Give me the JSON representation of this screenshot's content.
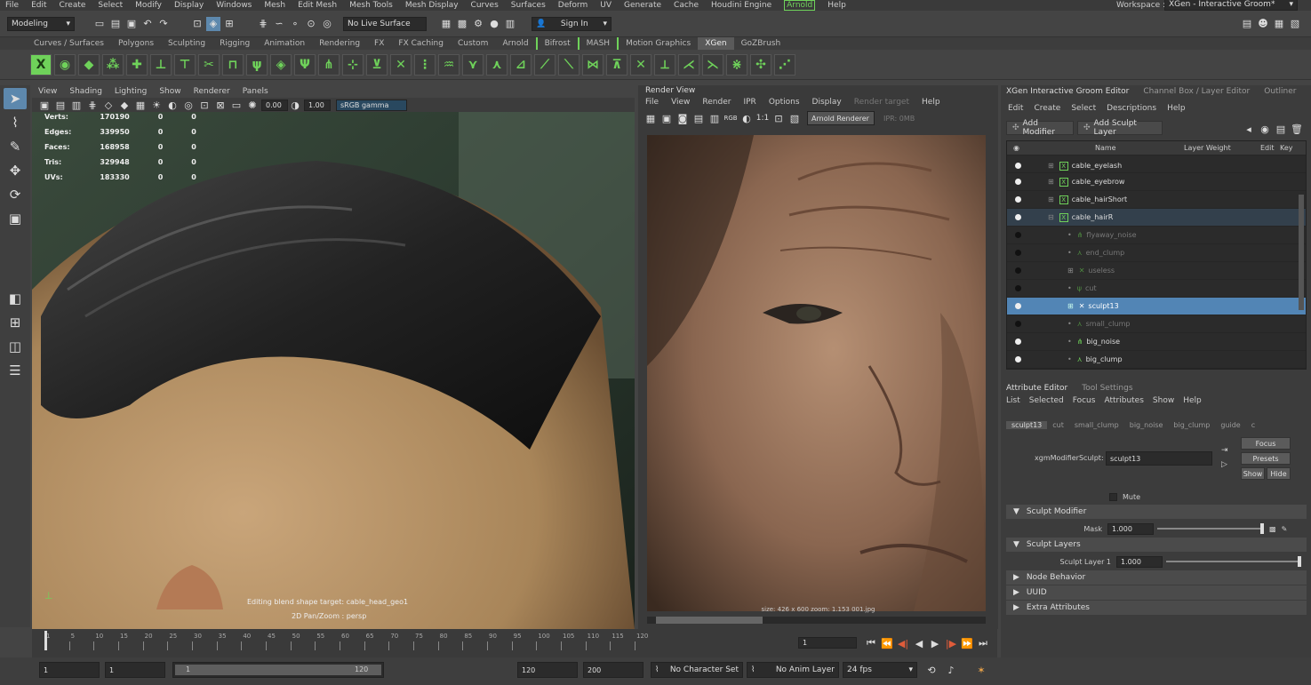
{
  "menubar": {
    "items": [
      "File",
      "Edit",
      "Create",
      "Select",
      "Modify",
      "Display",
      "Windows",
      "Mesh",
      "Edit Mesh",
      "Mesh Tools",
      "Mesh Display",
      "Curves",
      "Surfaces",
      "Deform",
      "UV",
      "Generate",
      "Cache",
      "Houdini Engine",
      "Arnold",
      "Help"
    ],
    "workspace_label": "Workspace :",
    "workspace_value": "XGen - Interactive Groom*"
  },
  "statusline": {
    "mode": "Modeling",
    "live_surface": "No Live Surface",
    "sign_in": "Sign In"
  },
  "shelf_tabs": [
    "Curves / Surfaces",
    "Polygons",
    "Sculpting",
    "Rigging",
    "Animation",
    "Rendering",
    "FX",
    "FX Caching",
    "Custom",
    "Arnold",
    "Bifrost",
    "MASH",
    "Motion Graphics",
    "XGen",
    "GoZBrush"
  ],
  "shelf_active": "XGen",
  "viewport": {
    "menu": [
      "View",
      "Shading",
      "Lighting",
      "Show",
      "Renderer",
      "Panels"
    ],
    "exposure": "0.00",
    "gamma": "1.00",
    "colorspace": "sRGB gamma",
    "hud": [
      {
        "label": "Verts:",
        "v1": "170190",
        "v2": "0",
        "v3": "0"
      },
      {
        "label": "Edges:",
        "v1": "339950",
        "v2": "0",
        "v3": "0"
      },
      {
        "label": "Faces:",
        "v1": "168958",
        "v2": "0",
        "v3": "0"
      },
      {
        "label": "Tris:",
        "v1": "329948",
        "v2": "0",
        "v3": "0"
      },
      {
        "label": "UVs:",
        "v1": "183330",
        "v2": "0",
        "v3": "0"
      }
    ],
    "caption1": "Editing blend shape target: cable_head_geo1",
    "caption2": "2D Pan/Zoom : persp"
  },
  "renderview": {
    "title": "Render View",
    "menu": [
      "File",
      "View",
      "Render",
      "IPR",
      "Options",
      "Display",
      "Render target",
      "Help"
    ],
    "rgb": "RGB",
    "ratio": "1:1",
    "renderer": "Arnold Renderer",
    "ipr": "IPR: 0MB",
    "status": "size: 426 x 600  zoom: 1.153  001.jpg"
  },
  "xgen": {
    "tabs": [
      "XGen Interactive Groom Editor",
      "Channel Box / Layer Editor",
      "Outliner"
    ],
    "menu": [
      "Edit",
      "Create",
      "Select",
      "Descriptions",
      "Help"
    ],
    "add_modifier": "Add Modifier",
    "add_sculpt": "Add Sculpt Layer",
    "columns": {
      "name": "Name",
      "weight": "Layer Weight",
      "edit": "Edit",
      "key": "Key"
    },
    "rows": [
      {
        "name": "cable_eyelash",
        "type": "desc"
      },
      {
        "name": "cable_eyebrow",
        "type": "desc"
      },
      {
        "name": "cable_hairShort",
        "type": "desc"
      },
      {
        "name": "cable_hairR",
        "type": "desc-open"
      },
      {
        "name": "flyaway_noise",
        "type": "mod-dim"
      },
      {
        "name": "end_clump",
        "type": "mod-dim"
      },
      {
        "name": "useless",
        "type": "mod-dim"
      },
      {
        "name": "cut",
        "type": "mod-dim"
      },
      {
        "name": "sculpt13",
        "type": "selected"
      },
      {
        "name": "small_clump",
        "type": "mod-dim"
      },
      {
        "name": "big_noise",
        "type": "mod"
      },
      {
        "name": "big_clump",
        "type": "mod"
      }
    ]
  },
  "attr": {
    "tabs": [
      "Attribute Editor",
      "Tool Settings"
    ],
    "menu": [
      "List",
      "Selected",
      "Focus",
      "Attributes",
      "Show",
      "Help"
    ],
    "node_tabs": [
      "sculpt13",
      "cut",
      "small_clump",
      "big_noise",
      "big_clump",
      "guide",
      "c"
    ],
    "node_label": "xgmModifierSculpt:",
    "node_value": "sculpt13",
    "focus": "Focus",
    "presets": "Presets",
    "show": "Show",
    "hide": "Hide",
    "mute": "Mute",
    "sect_sculpt_modifier": "Sculpt Modifier",
    "mask_label": "Mask",
    "mask_value": "1.000",
    "sect_sculpt_layers": "Sculpt Layers",
    "layer1_label": "Sculpt Layer 1",
    "layer1_value": "1.000",
    "sect_node_behavior": "Node Behavior",
    "sect_uuid": "UUID",
    "sect_extra": "Extra Attributes"
  },
  "timeline": {
    "ticks": [
      "1",
      "5",
      "10",
      "15",
      "20",
      "25",
      "30",
      "35",
      "40",
      "45",
      "50",
      "55",
      "60",
      "65",
      "70",
      "75",
      "80",
      "85",
      "90",
      "95",
      "100",
      "105",
      "110",
      "115",
      "120"
    ],
    "current": "1"
  },
  "range": {
    "start": "1",
    "start2": "1",
    "slider_start": "1",
    "slider_end": "120",
    "end": "120",
    "end2": "200",
    "char_set": "No Character Set",
    "anim_layer": "No Anim Layer",
    "fps": "24 fps"
  }
}
